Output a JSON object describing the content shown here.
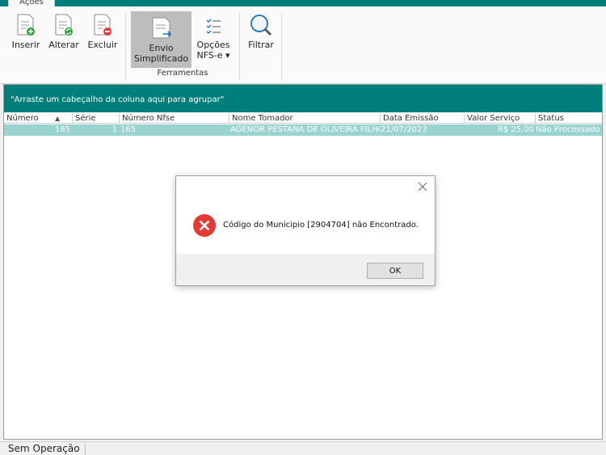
{
  "ribbon": {
    "tab_label": "Ações",
    "buttons": {
      "inserir": "Inserir",
      "alterar": "Alterar",
      "excluir": "Excluir",
      "envio_line1": "Envio",
      "envio_line2": "Simplificado",
      "opcoes_line1": "Opções",
      "opcoes_line2": "NFS-e ▾",
      "filtrar": "Filtrar"
    },
    "group_label": "Ferramentas"
  },
  "grid": {
    "group_hint": "\"Arraste um cabeçalho da coluna aqui para agrupar\"",
    "columns": [
      "Número",
      "Série",
      "Número Nfse",
      "Nome Tomador",
      "Data Emissão",
      "Valor Serviço",
      "Status"
    ],
    "rows": [
      {
        "numero": "165",
        "serie": "1",
        "numero_nfse": "165",
        "nome_tomador": "AGENOR PESTANA DE OLIVEIRA FILHO",
        "data_emissao": "21/07/2023",
        "valor_servico": "R$ 25,00",
        "status": "Não Processado"
      }
    ]
  },
  "dialog": {
    "message": "Código do Municipio [2904704] não Encontrado.",
    "ok_label": "OK",
    "icon": "error-icon"
  },
  "statusbar": {
    "text": "Sem Operação"
  },
  "colors": {
    "accent": "#007f7a",
    "selected_row": "#9ad4d1",
    "error": "#e53935"
  }
}
